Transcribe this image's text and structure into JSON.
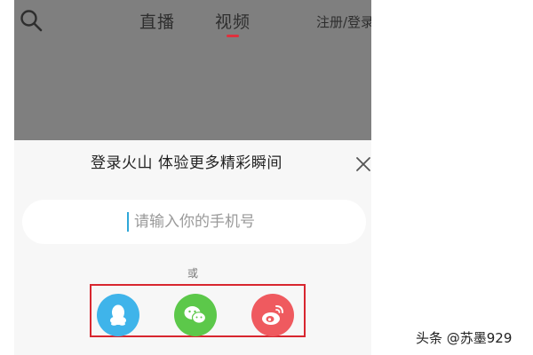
{
  "header": {
    "tabs": [
      {
        "label": "直播"
      },
      {
        "label": "视频"
      }
    ],
    "login_label": "注册/登录",
    "active_tab_color": "#e0303d"
  },
  "login_sheet": {
    "title": "登录火山 体验更多精彩瞬间",
    "phone_placeholder": "请输入你的手机号",
    "or_text": "或",
    "social_buttons": [
      {
        "icon": "qq-icon",
        "color": "#3fb4ea"
      },
      {
        "icon": "wechat-icon",
        "color": "#5cc84a"
      },
      {
        "icon": "weibo-icon",
        "color": "#ef5a5f"
      }
    ],
    "highlight_color": "#d8262f"
  },
  "watermark": "头条 @苏墨929"
}
